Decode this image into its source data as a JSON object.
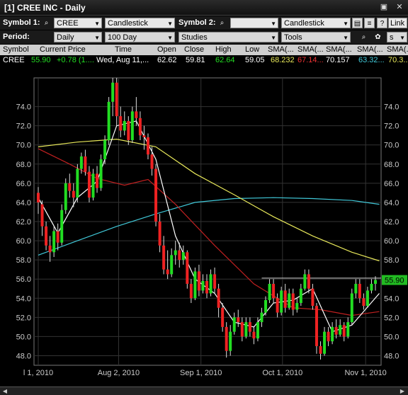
{
  "window": {
    "title": "[1] CREE INC - Daily"
  },
  "toolbar1": {
    "symbol1_label": "Symbol 1:",
    "symbol1_value": "CREE",
    "chart_type1": "Candlestick",
    "symbol2_label": "Symbol 2:",
    "symbol2_value": "",
    "chart_type2": "Candlestick",
    "help": "?",
    "link": "Link"
  },
  "toolbar2": {
    "period_label": "Period:",
    "period_value": "Daily",
    "range_value": "100 Day",
    "studies": "Studies",
    "tools": "Tools",
    "s_value": "s"
  },
  "quote": {
    "headers": [
      "Symbol",
      "Current Price",
      "Time",
      "Open",
      "Close",
      "High",
      "Low",
      "SMA(...",
      "SMA(...",
      "SMA(...",
      "SMA(...",
      "SMA(..."
    ],
    "row": [
      "CREE",
      "55.90",
      "+0.78 (1....",
      "Wed, Aug 11,...",
      "62.62",
      "59.81",
      "62.64",
      "59.05",
      "68.232",
      "67.14...",
      "70.157",
      "63.32...",
      "70.3..."
    ]
  },
  "colors": {
    "up": "#22dd22",
    "down": "#ee2222",
    "sma_yellow": "#e8e85a",
    "sma_red": "#c02020",
    "sma_cyan": "#40c8d8",
    "sma_white": "#ffffff",
    "price_tag": "#22bb22"
  },
  "chart_data": {
    "type": "candlestick",
    "ylim": [
      47,
      77
    ],
    "y_ticks": [
      48.0,
      50.0,
      52.0,
      54.0,
      56.0,
      58.0,
      60.0,
      62.0,
      64.0,
      66.0,
      68.0,
      70.0,
      72.0,
      74.0
    ],
    "x_labels": [
      "l 1, 2010",
      "Aug 2, 2010",
      "Sep 1, 2010",
      "Oct 1, 2010",
      "Nov 1, 2010"
    ],
    "last_price_tag": "55.90",
    "resistance_level": 56.1,
    "candles": [
      [
        65.0,
        64.0,
        65.6,
        62.8
      ],
      [
        63.8,
        61.5,
        64.2,
        60.5
      ],
      [
        61.5,
        59.5,
        62.0,
        59.0
      ],
      [
        59.5,
        58.8,
        60.5,
        57.8
      ],
      [
        58.8,
        61.0,
        61.5,
        58.3
      ],
      [
        61.0,
        59.8,
        61.8,
        59.0
      ],
      [
        59.8,
        63.2,
        63.8,
        59.5
      ],
      [
        63.2,
        66.0,
        66.5,
        62.8
      ],
      [
        66.0,
        65.2,
        67.0,
        64.5
      ],
      [
        65.2,
        64.5,
        66.0,
        63.5
      ],
      [
        64.5,
        67.5,
        68.0,
        64.0
      ],
      [
        67.5,
        68.8,
        69.2,
        67.0
      ],
      [
        68.8,
        67.2,
        69.5,
        66.8
      ],
      [
        67.2,
        64.5,
        67.8,
        64.0
      ],
      [
        64.5,
        67.0,
        67.5,
        64.2
      ],
      [
        67.0,
        65.5,
        67.8,
        65.0
      ],
      [
        65.5,
        68.5,
        69.0,
        65.2
      ],
      [
        68.5,
        70.5,
        71.0,
        68.0
      ],
      [
        70.5,
        74.5,
        75.0,
        70.0
      ],
      [
        74.5,
        76.5,
        77.0,
        73.0
      ],
      [
        76.5,
        73.0,
        77.0,
        72.0
      ],
      [
        73.0,
        71.5,
        74.0,
        70.8
      ],
      [
        71.5,
        72.5,
        73.5,
        71.0
      ],
      [
        72.5,
        70.5,
        73.0,
        70.0
      ],
      [
        70.5,
        73.5,
        74.0,
        70.2
      ],
      [
        73.5,
        72.8,
        75.0,
        72.0
      ],
      [
        72.8,
        71.0,
        73.5,
        70.5
      ],
      [
        71.0,
        70.8,
        72.0,
        69.5
      ],
      [
        70.8,
        69.0,
        71.2,
        68.5
      ],
      [
        69.0,
        67.5,
        69.8,
        66.8
      ],
      [
        67.5,
        62.0,
        68.0,
        61.5
      ],
      [
        62.0,
        59.5,
        62.8,
        58.8
      ],
      [
        59.5,
        57.0,
        60.5,
        56.5
      ],
      [
        57.0,
        56.5,
        59.0,
        56.0
      ],
      [
        56.5,
        58.5,
        59.2,
        56.2
      ],
      [
        58.5,
        59.0,
        60.0,
        57.5
      ],
      [
        59.0,
        58.0,
        59.8,
        57.2
      ],
      [
        58.0,
        58.8,
        59.5,
        57.5
      ],
      [
        58.8,
        55.5,
        59.0,
        55.0
      ],
      [
        55.5,
        54.0,
        56.0,
        53.5
      ],
      [
        54.0,
        56.8,
        57.2,
        53.8
      ],
      [
        56.8,
        54.8,
        57.5,
        54.2
      ],
      [
        54.8,
        55.8,
        56.5,
        54.5
      ],
      [
        55.8,
        54.5,
        56.5,
        54.0
      ],
      [
        54.5,
        56.5,
        57.0,
        54.2
      ],
      [
        56.5,
        55.0,
        57.2,
        54.5
      ],
      [
        55.0,
        53.0,
        55.5,
        52.0
      ],
      [
        53.0,
        51.0,
        53.5,
        50.5
      ],
      [
        51.0,
        48.5,
        51.5,
        47.8
      ],
      [
        48.5,
        50.5,
        51.2,
        48.0
      ],
      [
        50.5,
        52.0,
        52.5,
        50.2
      ],
      [
        52.0,
        51.5,
        52.8,
        51.0
      ],
      [
        51.5,
        50.0,
        52.0,
        49.5
      ],
      [
        50.0,
        51.5,
        52.0,
        49.8
      ],
      [
        51.5,
        50.5,
        52.0,
        50.0
      ],
      [
        50.5,
        49.8,
        51.0,
        49.2
      ],
      [
        49.8,
        51.5,
        52.0,
        49.5
      ],
      [
        51.5,
        52.5,
        53.0,
        51.0
      ],
      [
        52.5,
        53.8,
        54.2,
        52.2
      ],
      [
        53.8,
        55.5,
        56.0,
        53.5
      ],
      [
        55.5,
        54.0,
        56.0,
        53.5
      ],
      [
        54.0,
        52.5,
        54.5,
        52.0
      ],
      [
        52.5,
        54.8,
        55.2,
        52.2
      ],
      [
        54.8,
        53.0,
        55.5,
        52.5
      ],
      [
        53.0,
        54.5,
        55.0,
        52.8
      ],
      [
        54.5,
        52.8,
        55.0,
        52.2
      ],
      [
        52.8,
        53.5,
        54.0,
        52.5
      ],
      [
        53.5,
        55.0,
        55.5,
        53.2
      ],
      [
        55.0,
        56.5,
        57.0,
        54.8
      ],
      [
        56.5,
        55.0,
        57.0,
        54.5
      ],
      [
        55.0,
        53.2,
        55.5,
        52.8
      ],
      [
        53.2,
        49.0,
        53.5,
        48.2
      ],
      [
        49.0,
        48.2,
        49.5,
        47.6
      ],
      [
        48.2,
        50.5,
        51.0,
        48.0
      ],
      [
        50.5,
        49.5,
        51.0,
        49.0
      ],
      [
        49.5,
        51.0,
        51.5,
        49.2
      ],
      [
        51.0,
        50.2,
        51.8,
        49.8
      ],
      [
        50.2,
        51.2,
        51.8,
        50.0
      ],
      [
        51.2,
        50.0,
        51.5,
        49.5
      ],
      [
        50.0,
        51.5,
        52.0,
        49.8
      ],
      [
        51.5,
        54.5,
        55.0,
        51.2
      ],
      [
        54.5,
        55.5,
        56.0,
        54.0
      ],
      [
        55.5,
        54.0,
        56.0,
        53.5
      ],
      [
        54.0,
        53.2,
        54.5,
        52.8
      ],
      [
        53.2,
        54.8,
        55.2,
        53.0
      ],
      [
        54.8,
        55.5,
        56.0,
        54.5
      ],
      [
        55.5,
        55.9,
        56.3,
        54.8
      ]
    ],
    "sma_yellow": [
      [
        0,
        69.8
      ],
      [
        10,
        70.3
      ],
      [
        20,
        70.6
      ],
      [
        30,
        69.8
      ],
      [
        40,
        67.0
      ],
      [
        50,
        64.8
      ],
      [
        60,
        62.5
      ],
      [
        70,
        60.5
      ],
      [
        80,
        58.8
      ],
      [
        87,
        57.9
      ]
    ],
    "sma_red": [
      [
        0,
        69.6
      ],
      [
        8,
        68.0
      ],
      [
        15,
        66.5
      ],
      [
        22,
        65.8
      ],
      [
        28,
        66.4
      ],
      [
        35,
        63.8
      ],
      [
        45,
        59.5
      ],
      [
        55,
        55.5
      ],
      [
        65,
        53.0
      ],
      [
        72,
        52.8
      ],
      [
        80,
        52.2
      ],
      [
        87,
        52.6
      ]
    ],
    "sma_cyan": [
      [
        0,
        58.5
      ],
      [
        10,
        60.0
      ],
      [
        20,
        61.5
      ],
      [
        30,
        62.8
      ],
      [
        40,
        64.0
      ],
      [
        50,
        64.4
      ],
      [
        60,
        64.5
      ],
      [
        70,
        64.4
      ],
      [
        80,
        64.2
      ],
      [
        87,
        63.8
      ]
    ],
    "sma_white": [
      [
        0,
        64.5
      ],
      [
        5,
        60.8
      ],
      [
        10,
        64.5
      ],
      [
        15,
        66.2
      ],
      [
        20,
        72.0
      ],
      [
        25,
        72.5
      ],
      [
        30,
        68.5
      ],
      [
        35,
        60.5
      ],
      [
        40,
        56.0
      ],
      [
        45,
        54.5
      ],
      [
        50,
        51.5
      ],
      [
        55,
        51.0
      ],
      [
        60,
        53.5
      ],
      [
        65,
        53.8
      ],
      [
        70,
        55.0
      ],
      [
        75,
        50.5
      ],
      [
        80,
        51.2
      ],
      [
        87,
        54.5
      ]
    ]
  }
}
